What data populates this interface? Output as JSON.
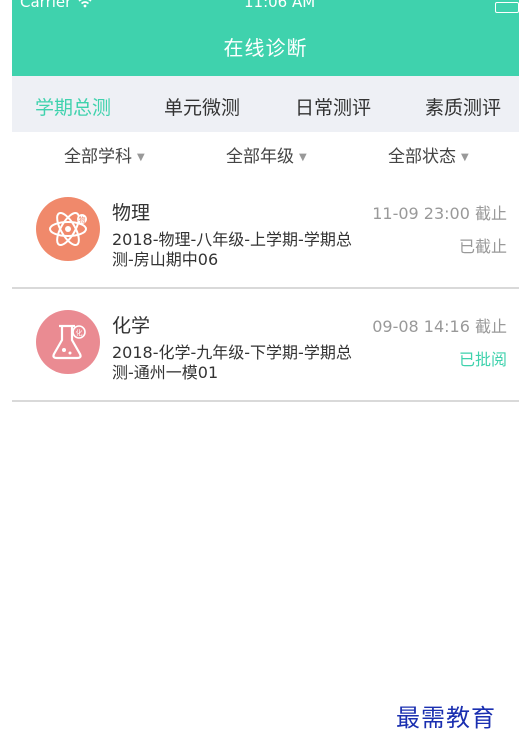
{
  "status_bar": {
    "carrier": "Carrier",
    "time": "11:06 AM"
  },
  "header": {
    "title": "在线诊断"
  },
  "tabs": [
    {
      "label": "学期总测",
      "active": true
    },
    {
      "label": "单元微测",
      "active": false
    },
    {
      "label": "日常测评",
      "active": false
    },
    {
      "label": "素质测评",
      "active": false
    }
  ],
  "filters": [
    {
      "label": "全部学科"
    },
    {
      "label": "全部年级"
    },
    {
      "label": "全部状态"
    }
  ],
  "exams": [
    {
      "subject": "物理",
      "icon": "atom-icon",
      "title_line1": "2018-物理-八年级-上学期-学期总",
      "title_line2": "测-房山期中06",
      "deadline": "11-09 23:00 截止",
      "status": "已截止",
      "status_color": "#999999",
      "icon_color": "#f0896b"
    },
    {
      "subject": "化学",
      "icon": "flask-icon",
      "title_line1": "2018-化学-九年级-下学期-学期总",
      "title_line2": "测-通州一模01",
      "deadline": "09-08 14:16 截止",
      "status": "已批阅",
      "status_color": "#3fd2ad",
      "icon_color": "#ea8b92"
    }
  ],
  "watermark": "最需教育"
}
